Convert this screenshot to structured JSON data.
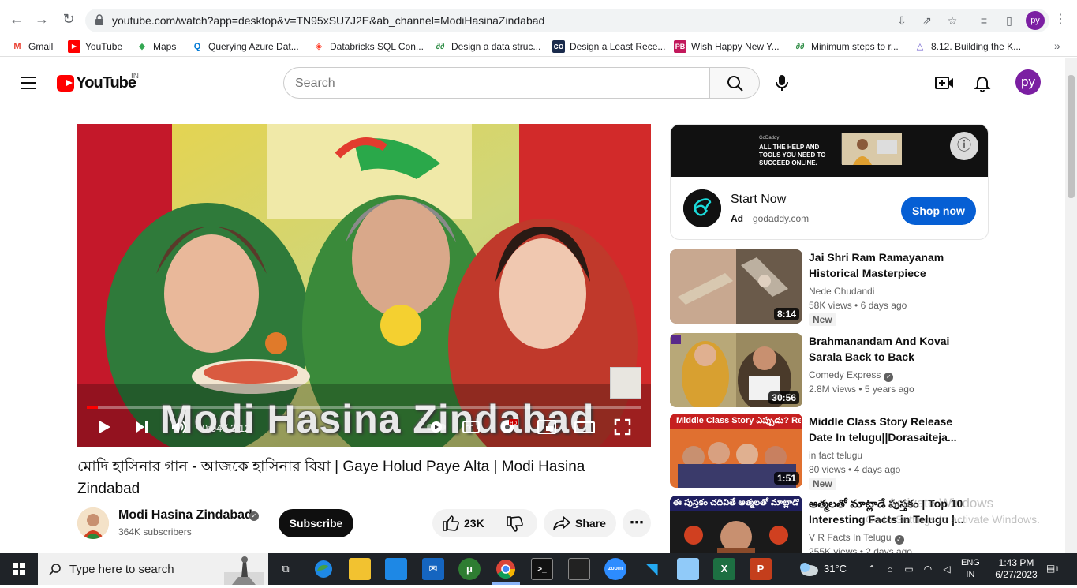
{
  "browser": {
    "url": "youtube.com/watch?app=desktop&v=TN95xSU7J2E&ab_channel=ModiHasinaZindabad",
    "profile_initials": "py",
    "bookmarks": [
      {
        "label": "Gmail",
        "icon": "gmail-icon",
        "color": "#ea4335"
      },
      {
        "label": "YouTube",
        "icon": "youtube-icon",
        "color": "#ff0000"
      },
      {
        "label": "Maps",
        "icon": "maps-icon",
        "color": "#34a853"
      },
      {
        "label": "Querying Azure Dat...",
        "icon": "search-icon",
        "color": "#0078d4"
      },
      {
        "label": "Databricks SQL Con...",
        "icon": "databricks-icon",
        "color": "#ff3621"
      },
      {
        "label": "Design a data struc...",
        "icon": "gfg-icon",
        "color": "#2f8d46"
      },
      {
        "label": "Design a Least Rece...",
        "icon": "leetcode-icon",
        "color": "#1a2b4c"
      },
      {
        "label": "Wish Happy New Y...",
        "icon": "pb-icon",
        "color": "#c2185b"
      },
      {
        "label": "Minimum steps to r...",
        "icon": "gfg-icon",
        "color": "#2f8d46"
      },
      {
        "label": "8.12. Building the K...",
        "icon": "triangle-icon",
        "color": "#6a5acd"
      }
    ]
  },
  "header": {
    "logo_text": "YouTube",
    "country": "IN",
    "search_placeholder": "Search",
    "avatar_initials": "py"
  },
  "player": {
    "caption": "Modi Hasina Zindabad",
    "current_time": "0:04",
    "duration": "3:12",
    "progress": 0.02
  },
  "video": {
    "title": "মোদি হাসিনার গান - আজকে হাসিনার বিয়া | Gaye Holud Paye Alta | Modi Hasina Zindabad",
    "channel": "Modi Hasina Zindabad",
    "subscribers": "364K subscribers",
    "subscribe_label": "Subscribe",
    "likes": "23K",
    "share_label": "Share"
  },
  "ad": {
    "banner_brand": "GoDaddy",
    "banner_text": "ALL THE HELP AND TOOLS YOU NEED TO SUCCEED ONLINE.",
    "title": "Start Now",
    "badge": "Ad",
    "domain": "godaddy.com",
    "cta": "Shop now"
  },
  "recommendations": [
    {
      "title": "Jai Shri Ram Ramayanam Historical Masterpiece Movie...",
      "channel": "Nede Chudandi",
      "verified": false,
      "views": "58K views",
      "age": "6 days ago",
      "duration": "8:14",
      "new": "New"
    },
    {
      "title": "Brahmanandam And Kovai Sarala Back to Back Comedy...",
      "channel": "Comedy Express",
      "verified": true,
      "views": "2.8M views",
      "age": "5 years ago",
      "duration": "30:56",
      "new": ""
    },
    {
      "title": "Middle Class Story Release Date In telugu||Dorasaiteja...",
      "channel": "in fact telugu",
      "verified": false,
      "views": "80 views",
      "age": "4 days ago",
      "duration": "1:51",
      "new": "New"
    },
    {
      "title": "ఆత్మలతో మాట్లాడే పుస్తకం | Top 10 Interesting Facts in Telugu |...",
      "channel": "V R Facts In Telugu",
      "verified": true,
      "views": "255K views",
      "age": "2 days ago",
      "duration": "",
      "new": ""
    }
  ],
  "rec_thumb_text": {
    "third": "Middle Class Story ఎప్పుడు? Release డేట్?",
    "fourth": "ఈ పుస్తకం చదివితే ఆత్మలతో మాట్లాడొచ్చా?"
  },
  "watermark_activate": {
    "line1": "Activate Windows",
    "line2": "Go to Settings to activate Windows."
  },
  "taskbar": {
    "search_label": "Type here to search",
    "temperature": "31°C",
    "lang_line1": "ENG",
    "lang_line2": "IN",
    "time": "1:43 PM",
    "date": "6/27/2023",
    "notifications": "1"
  }
}
